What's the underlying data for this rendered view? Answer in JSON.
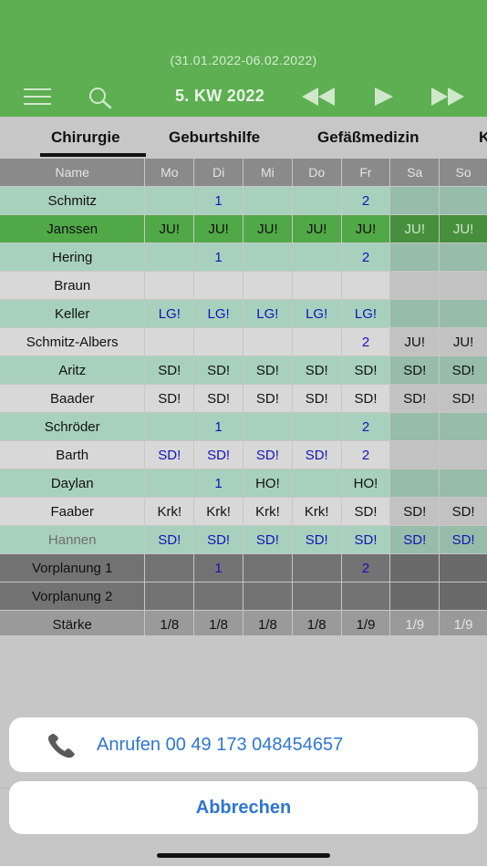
{
  "header": {
    "date_range": "(31.01.2022-06.02.2022)",
    "week_label": "5. KW 2022"
  },
  "tabs": [
    {
      "label": "Chirurgie",
      "active": true
    },
    {
      "label": "Geburtshilfe",
      "active": false
    },
    {
      "label": "Gefäßmedizin",
      "active": false
    },
    {
      "label": "K",
      "active": false
    }
  ],
  "table": {
    "columns": [
      "Name",
      "Mo",
      "Di",
      "Mi",
      "Do",
      "Fr",
      "Sa",
      "So"
    ],
    "rows": [
      {
        "name": "Schmitz",
        "style": "green",
        "cells": [
          "",
          "1",
          "",
          "",
          "2",
          "",
          ""
        ]
      },
      {
        "name": "Janssen",
        "style": "bright",
        "cells": [
          "JU!",
          "JU!",
          "JU!",
          "JU!",
          "JU!",
          "JU!",
          "JU!"
        ]
      },
      {
        "name": "Hering",
        "style": "green",
        "cells": [
          "",
          "1",
          "",
          "",
          "2",
          "",
          ""
        ]
      },
      {
        "name": "Braun",
        "style": "gray",
        "cells": [
          "",
          "",
          "",
          "",
          "",
          "",
          ""
        ]
      },
      {
        "name": "Keller",
        "style": "green",
        "cells": [
          "LG!",
          "LG!",
          "LG!",
          "LG!",
          "LG!",
          "",
          ""
        ]
      },
      {
        "name": "Schmitz-Albers",
        "style": "gray",
        "cells": [
          "",
          "",
          "",
          "",
          "2",
          "JU!",
          "JU!"
        ]
      },
      {
        "name": "Aritz",
        "style": "green",
        "cells": [
          "SD!",
          "SD!",
          "SD!",
          "SD!",
          "SD!",
          "SD!",
          "SD!"
        ]
      },
      {
        "name": "Baader",
        "style": "gray",
        "cells": [
          "SD!",
          "SD!",
          "SD!",
          "SD!",
          "SD!",
          "SD!",
          "SD!"
        ]
      },
      {
        "name": "Schröder",
        "style": "green",
        "cells": [
          "",
          "1",
          "",
          "",
          "2",
          "",
          ""
        ]
      },
      {
        "name": "Barth",
        "style": "gray",
        "cells": [
          "SD!",
          "SD!",
          "SD!",
          "SD!",
          "2",
          "",
          ""
        ]
      },
      {
        "name": "Daylan",
        "style": "green",
        "cells": [
          "",
          "1",
          "HO!",
          "",
          "HO!",
          "",
          ""
        ]
      },
      {
        "name": "Faaber",
        "style": "gray",
        "cells": [
          "Krk!",
          "Krk!",
          "Krk!",
          "Krk!",
          "SD!",
          "SD!",
          "SD!"
        ]
      },
      {
        "name": "Hannen",
        "style": "green",
        "cells": [
          "SD!",
          "SD!",
          "SD!",
          "SD!",
          "SD!",
          "SD!",
          "SD!"
        ]
      },
      {
        "name": "Vorplanung 1",
        "style": "dark",
        "cells": [
          "",
          "1",
          "",
          "",
          "2",
          "",
          ""
        ]
      },
      {
        "name": "Vorplanung 2",
        "style": "dark",
        "cells": [
          "",
          "",
          "",
          "",
          "",
          "",
          ""
        ]
      }
    ],
    "summary": {
      "label": "Stärke",
      "cells": [
        "1/8",
        "1/8",
        "1/8",
        "1/8",
        "1/9",
        "1/9",
        "1/9"
      ]
    }
  },
  "action_sheet": {
    "call_label": "Anrufen 00 49 173 048454657",
    "cancel_label": "Abbrechen"
  },
  "colors": {
    "header_green": "#5daf52",
    "accent_blue": "#2f76d2",
    "cell_text_blue": "#1414b8"
  }
}
